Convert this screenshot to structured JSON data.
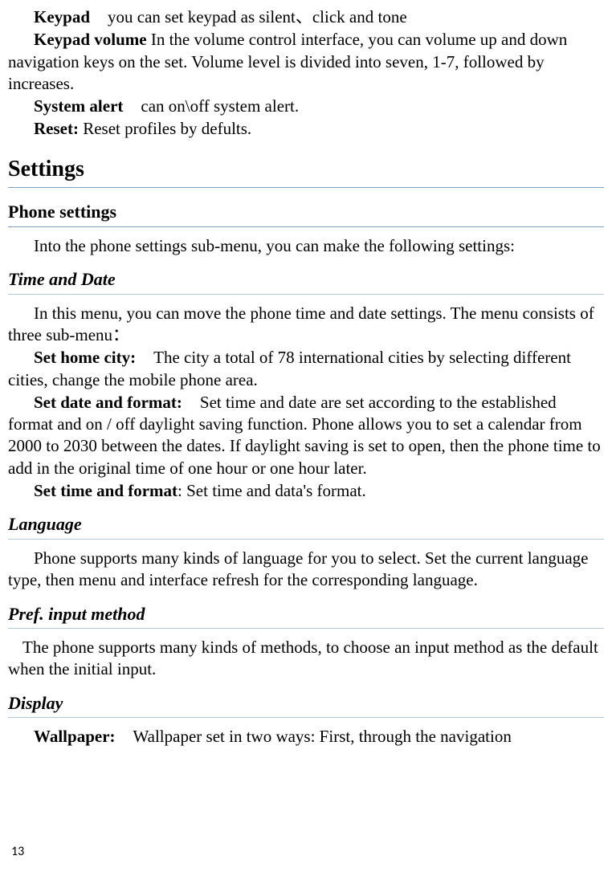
{
  "top": {
    "keypad_label": "Keypad",
    "keypad_text": "you can set keypad as silent、click and tone",
    "keypad_volume_label": "Keypad volume",
    "keypad_volume_text_a": " In the volume control interface, you can volume up and down navigation keys on the set. Volume level is divided into seven, 1-7, followed by increases.",
    "system_alert_label": "System alert",
    "system_alert_text": "can on\\off system alert.",
    "reset_label": "Reset:",
    "reset_text": " Reset profiles by defults."
  },
  "settings_heading": "Settings",
  "phone_settings_heading": "Phone settings",
  "phone_settings_intro": "Into the phone settings sub-menu, you can make the following settings:",
  "time_date_heading": "Time and Date",
  "time_date_intro": "In this menu, you can move the phone time and date settings. The menu consists of three sub-menu：",
  "set_home_city_label": "Set home city:",
  "set_home_city_text": "The city a total of 78 international cities by selecting different cities, change the mobile phone area.",
  "set_date_format_label": "Set date and format:",
  "set_date_format_text": "Set time and date are set according to the established format and on / off daylight saving function. Phone allows you to set a calendar from 2000 to 2030 between the dates. If daylight saving is set to open, then the phone time to add in the original time of one hour or one hour later.",
  "set_time_format_label": "Set time and format",
  "set_time_format_text": ": Set time and data's format.",
  "language_heading": "Language",
  "language_text": "Phone supports many kinds of language for you to select. Set the current language type, then menu and interface refresh for the corresponding language.",
  "pref_input_heading": "Pref. input method",
  "pref_input_text": "The phone supports many kinds of methods, to choose an input method as the default when the initial input.",
  "display_heading": "Display",
  "wallpaper_label": "Wallpaper:",
  "wallpaper_text": "Wallpaper set in two ways: First, through the navigation",
  "page_number": "13"
}
